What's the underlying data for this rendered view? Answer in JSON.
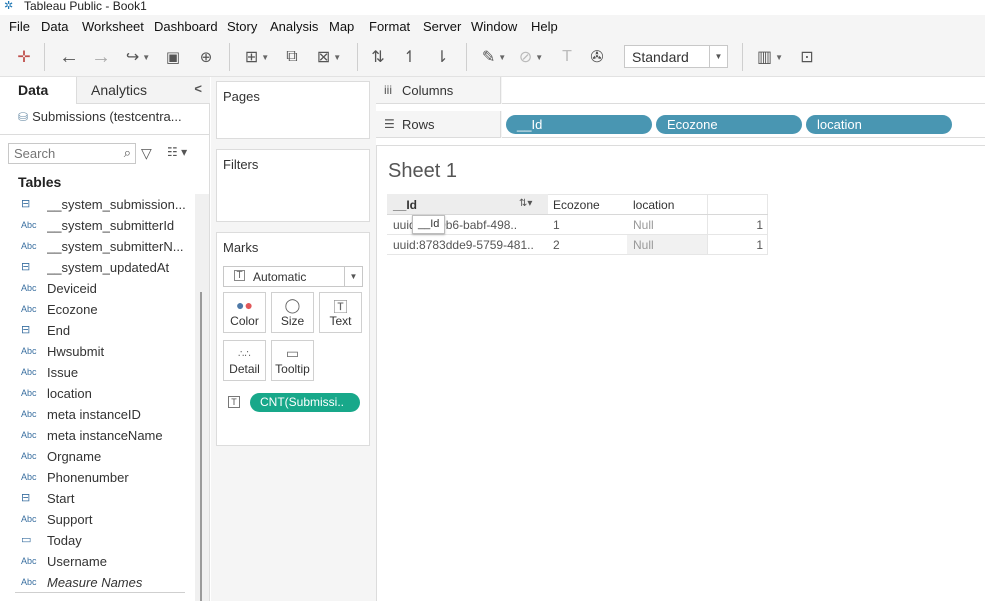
{
  "window": {
    "title": "Tableau Public - Book1"
  },
  "menu": [
    "File",
    "Data",
    "Worksheet",
    "Dashboard",
    "Story",
    "Analysis",
    "Map",
    "Format",
    "Server",
    "Window",
    "Help"
  ],
  "toolbar": {
    "fit_value": "Standard"
  },
  "data_pane": {
    "tab_data": "Data",
    "tab_analytics": "Analytics",
    "datasource": "Submissions (testcentra...",
    "search_placeholder": "Search",
    "tables_heading": "Tables",
    "fields": [
      {
        "type": "calendar",
        "name": "__system_submission..."
      },
      {
        "type": "Abc",
        "name": "__system_submitterId"
      },
      {
        "type": "Abc",
        "name": "__system_submitterN..."
      },
      {
        "type": "calendar",
        "name": "__system_updatedAt"
      },
      {
        "type": "Abc",
        "name": "Deviceid"
      },
      {
        "type": "Abc",
        "name": "Ecozone"
      },
      {
        "type": "calendar",
        "name": "End"
      },
      {
        "type": "Abc",
        "name": "Hwsubmit"
      },
      {
        "type": "Abc",
        "name": "Issue"
      },
      {
        "type": "Abc",
        "name": "location"
      },
      {
        "type": "Abc",
        "name": "meta instanceID"
      },
      {
        "type": "Abc",
        "name": "meta instanceName"
      },
      {
        "type": "Abc",
        "name": "Orgname"
      },
      {
        "type": "Abc",
        "name": "Phonenumber"
      },
      {
        "type": "calendar",
        "name": "Start"
      },
      {
        "type": "Abc",
        "name": "Support"
      },
      {
        "type": "date",
        "name": "Today"
      },
      {
        "type": "Abc",
        "name": "Username"
      },
      {
        "type": "Abc",
        "name": "Measure Names"
      }
    ]
  },
  "cards": {
    "pages": "Pages",
    "filters": "Filters",
    "marks": "Marks",
    "mark_type": "Automatic",
    "mark_buttons": [
      "Color",
      "Size",
      "Text",
      "Detail",
      "Tooltip"
    ],
    "text_pill": "CNT(Submissi.."
  },
  "shelves": {
    "columns_label": "Columns",
    "rows_label": "Rows",
    "rows_pills": [
      "__Id",
      "Ecozone",
      "location"
    ]
  },
  "view": {
    "sheet_title": "Sheet 1",
    "headers": [
      "__Id",
      "Ecozone",
      "location"
    ],
    "rows": [
      {
        "id": "uuid:82b0b6-babf-498..",
        "ecozone": "1",
        "location": "Null",
        "value": "1"
      },
      {
        "id": "uuid:8783dde9-5759-481..",
        "ecozone": "2",
        "location": "Null",
        "value": "1"
      }
    ],
    "tooltip": "__Id"
  },
  "colors": {
    "pill_blue": "#4996b2",
    "pill_green": "#18a88a"
  }
}
